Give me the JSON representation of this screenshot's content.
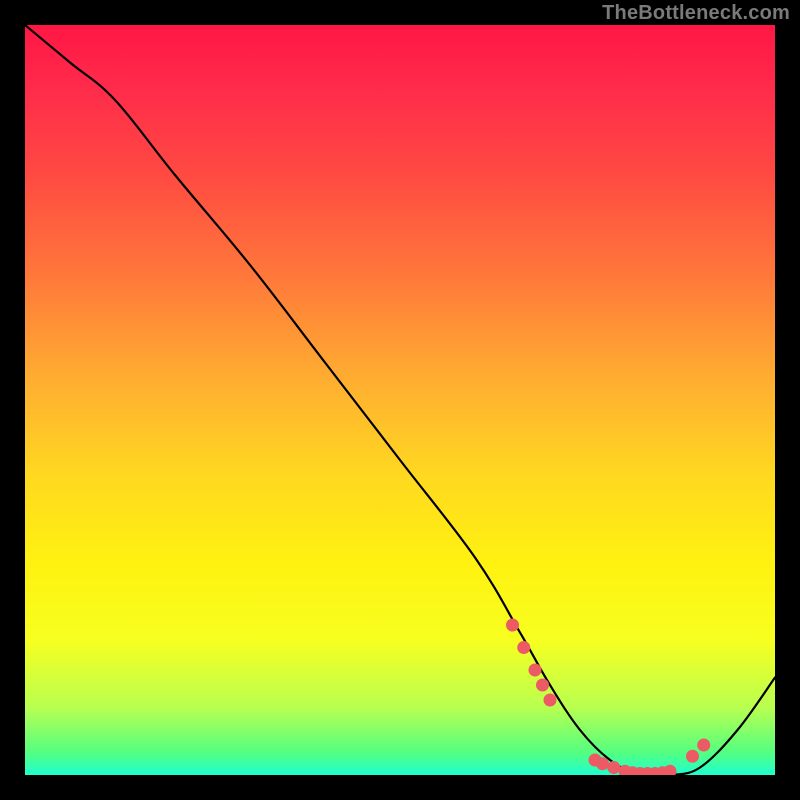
{
  "watermark": "TheBottleneck.com",
  "chart_data": {
    "type": "line",
    "title": "",
    "xlabel": "",
    "ylabel": "",
    "xlim": [
      0,
      100
    ],
    "ylim": [
      0,
      100
    ],
    "grid": false,
    "legend": false,
    "series": [
      {
        "name": "curve",
        "x": [
          0,
          6,
          12,
          20,
          30,
          40,
          50,
          60,
          66,
          70,
          74,
          78,
          82,
          86,
          90,
          95,
          100
        ],
        "values": [
          100,
          95,
          90,
          80,
          68,
          55,
          42,
          29,
          19,
          12,
          6,
          2,
          0,
          0,
          1,
          6,
          13
        ]
      }
    ],
    "markers": {
      "name": "highlight-dots",
      "color": "#ec5a63",
      "x": [
        65,
        66.5,
        68,
        69,
        70,
        76,
        77,
        78.5,
        80,
        81,
        82,
        83,
        84,
        85,
        86,
        89,
        90.5
      ],
      "values": [
        20,
        17,
        14,
        12,
        10,
        2,
        1.5,
        1,
        0.5,
        0.3,
        0.2,
        0.2,
        0.2,
        0.3,
        0.5,
        2.5,
        4
      ]
    }
  }
}
